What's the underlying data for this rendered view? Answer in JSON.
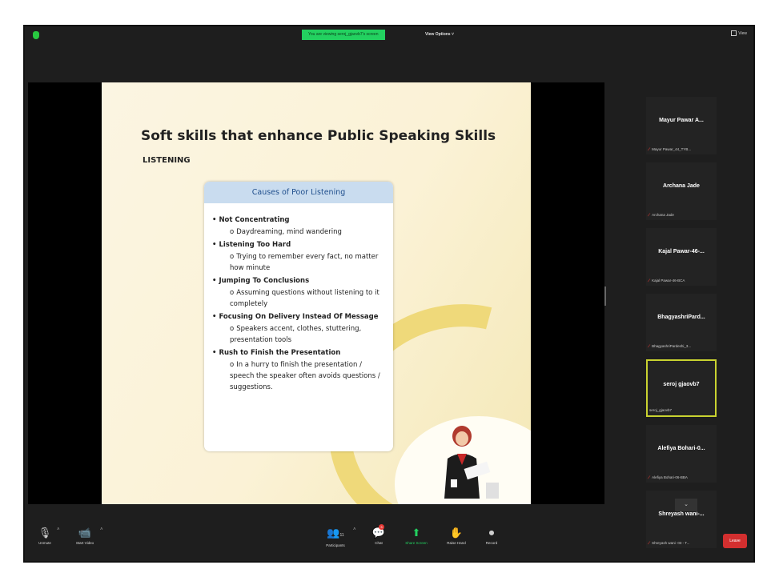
{
  "topbar": {
    "viewing_banner": "You are viewing seroj_gjaovb7's screen",
    "view_options": "View Options ˅",
    "view_button": "View"
  },
  "slide": {
    "title": "Soft skills that enhance Public Speaking Skills",
    "subtitle": "LISTENING",
    "card_title": "Causes of Poor Listening",
    "causes": [
      {
        "heading": "Not Concentrating",
        "detail": "Daydreaming, mind wandering"
      },
      {
        "heading": "Listening Too Hard",
        "detail": "Trying to remember every fact, no matter how minute"
      },
      {
        "heading": "Jumping To Conclusions",
        "detail": "Assuming questions without listening to it completely"
      },
      {
        "heading": "Focusing On Delivery Instead Of Message",
        "detail": "Speakers accent, clothes, stuttering, presentation tools"
      },
      {
        "heading": "Rush to Finish the Presentation",
        "detail": "In a hurry to finish the presentation / speech the speaker often avoids questions / suggestions."
      }
    ]
  },
  "participants": [
    {
      "name": "Mayur Pawar A...",
      "label": "Mayur Pawar_44_TYB...",
      "muted": true,
      "active": false
    },
    {
      "name": "Archana Jade",
      "label": "Archana Jade",
      "muted": true,
      "active": false
    },
    {
      "name": "Kajal Pawar-46-...",
      "label": "Kajal Pawar-46-BCA",
      "muted": true,
      "active": false
    },
    {
      "name": "BhagyashriPard...",
      "label": "BhagyashriPardeshi_3...",
      "muted": true,
      "active": false
    },
    {
      "name": "seroj gjaovb7",
      "label": "seroj_gjaovb7",
      "muted": false,
      "active": true
    },
    {
      "name": "Alefiya Bohari-0...",
      "label": "Alefiya Bohari-06-BBA",
      "muted": true,
      "active": false
    },
    {
      "name": "Shreyash wani-...",
      "label": "Shreyash wani- 03 - T...",
      "muted": true,
      "active": false
    }
  ],
  "toolbar": {
    "unmute": "Unmute",
    "start_video": "Start Video",
    "participants": "Participants",
    "participants_count": "11",
    "chat": "Chat",
    "chat_badge": "3",
    "share_screen": "Share Screen",
    "raise_hand": "Raise Hand",
    "record": "Record",
    "leave": "Leave"
  },
  "colors": {
    "banner_green": "#23d160",
    "active_border": "#c9d230",
    "leave_red": "#d32f2f",
    "card_header": "#c9dcef"
  }
}
